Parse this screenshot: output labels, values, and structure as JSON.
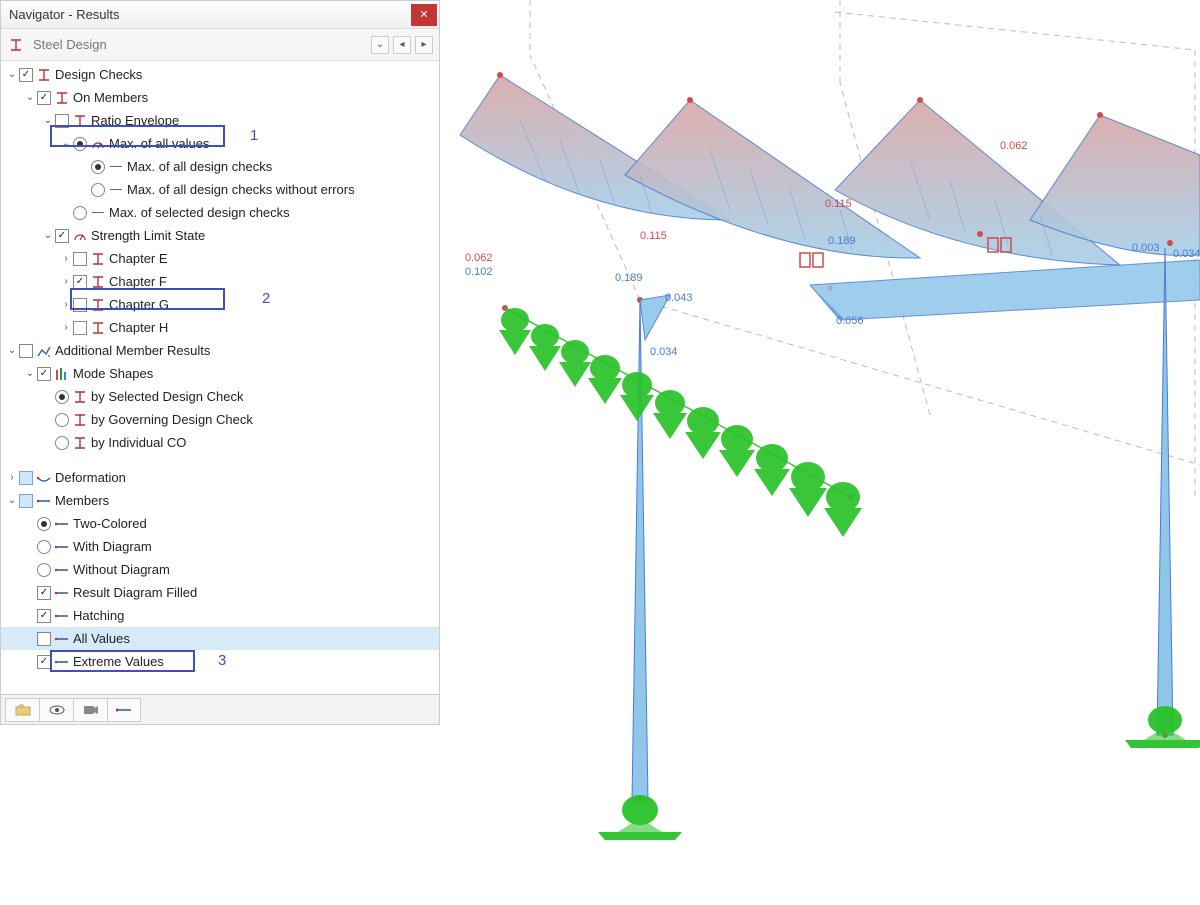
{
  "title": "Navigator - Results",
  "toolbar": {
    "label": "Steel Design"
  },
  "annotations": {
    "n1": "1",
    "n2": "2",
    "n3": "3"
  },
  "tree": {
    "design_checks": "Design Checks",
    "on_members": "On Members",
    "ratio_envelope": "Ratio Envelope",
    "max_all_values": "Max. of all values",
    "max_all_design_checks": "Max. of all design checks",
    "max_all_design_checks_wo_errors": "Max. of all design checks without errors",
    "max_selected_design_checks": "Max. of selected design checks",
    "strength_limit_state": "Strength Limit State",
    "chapter_e": "Chapter E",
    "chapter_f": "Chapter F",
    "chapter_g": "Chapter G",
    "chapter_h": "Chapter H",
    "additional_member_results": "Additional Member Results",
    "mode_shapes": "Mode Shapes",
    "by_selected_design_check": "by Selected Design Check",
    "by_governing_design_check": "by Governing Design Check",
    "by_individual_co": "by Individual CO",
    "deformation": "Deformation",
    "members": "Members",
    "two_colored": "Two-Colored",
    "with_diagram": "With Diagram",
    "without_diagram": "Without Diagram",
    "result_diagram_filled": "Result Diagram Filled",
    "hatching": "Hatching",
    "all_values": "All Values",
    "extreme_values": "Extreme Values"
  },
  "viewport_values": {
    "v1": "0.062",
    "v2": "0.102",
    "v3": "0.115",
    "v4": "0.189",
    "v5": "0.043",
    "v6": "0.034",
    "v7": "0.115",
    "v8": "0.189",
    "v9": "0.056",
    "v10": "0.062",
    "v11": "0.003",
    "v12": "0.034"
  }
}
